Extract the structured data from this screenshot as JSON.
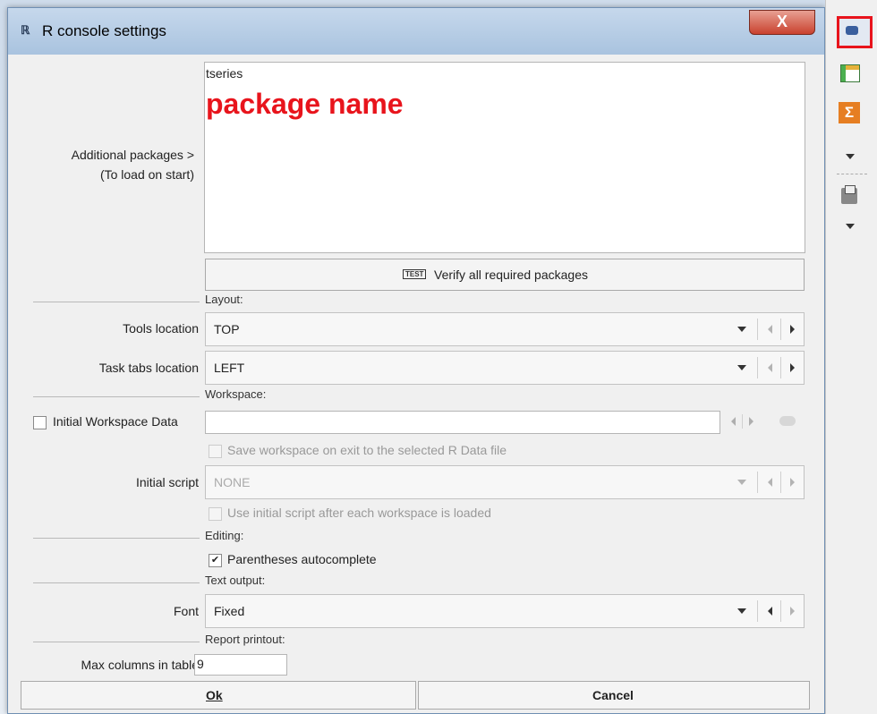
{
  "dialog": {
    "title": "R console settings",
    "close_label": "X",
    "packages_label": "Additional packages >",
    "packages_sublabel": "(To load on start)",
    "packages_value": "tseries",
    "annotation": "package name",
    "verify_label": "Verify all required packages",
    "verify_icon_text": "TEST",
    "sections": {
      "layout": "Layout:",
      "workspace": "Workspace:",
      "editing": "Editing:",
      "text_output": "Text output:",
      "report": "Report printout:"
    },
    "tools_location_label": "Tools location",
    "tools_location_value": "TOP",
    "task_tabs_label": "Task tabs location",
    "task_tabs_value": "LEFT",
    "initial_workspace_label": "Initial Workspace Data",
    "initial_workspace_value": "",
    "save_workspace_label": "Save workspace on exit to the selected R Data file",
    "initial_script_label": "Initial script",
    "initial_script_value": "NONE",
    "use_initial_script_label": "Use initial script after each workspace is loaded",
    "parentheses_label": "Parentheses autocomplete",
    "parentheses_checked": true,
    "font_label": "Font",
    "font_value": "Fixed",
    "max_columns_label": "Max columns in table",
    "max_columns_value": "9",
    "ok_label": "Ok",
    "cancel_label": "Cancel"
  },
  "toolbar": {
    "icons": [
      "r-console-icon",
      "table-icon",
      "sum-icon",
      "dropdown-icon",
      "print-icon",
      "dropdown-icon"
    ]
  },
  "colors": {
    "annotation": "#e8141c",
    "highlight": "#e8141c",
    "sum_icon_bg": "#e67e22"
  }
}
